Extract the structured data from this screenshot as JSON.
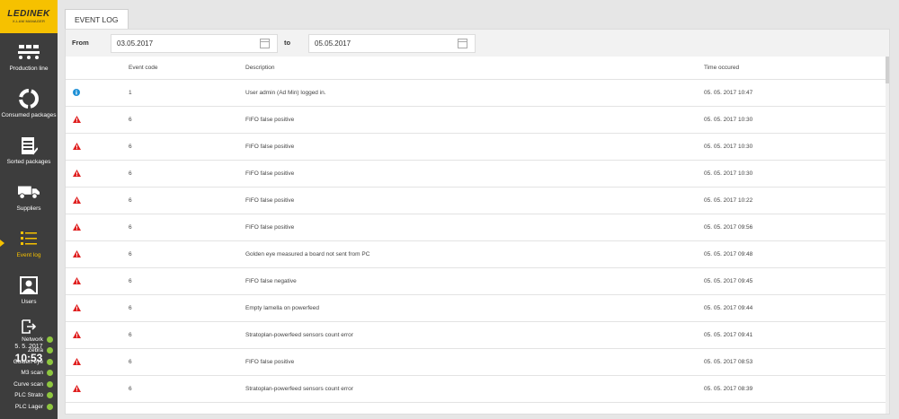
{
  "brand": {
    "name": "LEDINEK",
    "subtitle": "X-LAM MANAGER",
    "accent": "#f6c100"
  },
  "sidebar": {
    "items": [
      {
        "label": "Production line",
        "icon": "production-line-icon",
        "active": false
      },
      {
        "label": "Consumed packages",
        "icon": "consumed-packages-icon",
        "active": false
      },
      {
        "label": "Sorted packages",
        "icon": "sorted-packages-icon",
        "active": false
      },
      {
        "label": "Suppliers",
        "icon": "truck-icon",
        "active": false
      },
      {
        "label": "Event log",
        "icon": "list-icon",
        "active": true
      },
      {
        "label": "Users",
        "icon": "user-icon",
        "active": false
      }
    ],
    "logout_icon": "logout-icon"
  },
  "clock": {
    "date": "5. 5. 2017",
    "time": "10:53"
  },
  "statuses": [
    {
      "label": "Network",
      "color": "#8ec63f"
    },
    {
      "label": "Zebra",
      "color": "#8ec63f"
    },
    {
      "label": "Golden eye",
      "color": "#8ec63f"
    },
    {
      "label": "M3 scan",
      "color": "#8ec63f"
    },
    {
      "label": "Curve scan",
      "color": "#8ec63f"
    },
    {
      "label": "PLC Strato",
      "color": "#8ec63f"
    },
    {
      "label": "PLC Lager",
      "color": "#8ec63f"
    }
  ],
  "tab": {
    "label": "EVENT LOG"
  },
  "filter": {
    "from_label": "From",
    "from_value": "03.05.2017",
    "to_label": "to",
    "to_value": "05.05.2017"
  },
  "table": {
    "headers": {
      "code": "Event code",
      "description": "Description",
      "time": "Time occured"
    },
    "rows": [
      {
        "type": "info",
        "code": "1",
        "description": "User admin (Ad Min) logged in.",
        "time": "05. 05. 2017 10:47"
      },
      {
        "type": "warning",
        "code": "6",
        "description": "FIFO false positive",
        "time": "05. 05. 2017 10:30"
      },
      {
        "type": "warning",
        "code": "6",
        "description": "FIFO false positive",
        "time": "05. 05. 2017 10:30"
      },
      {
        "type": "warning",
        "code": "6",
        "description": "FIFO false positive",
        "time": "05. 05. 2017 10:30"
      },
      {
        "type": "warning",
        "code": "6",
        "description": "FIFO false positive",
        "time": "05. 05. 2017 10:22"
      },
      {
        "type": "warning",
        "code": "6",
        "description": "FIFO false positive",
        "time": "05. 05. 2017 09:56"
      },
      {
        "type": "warning",
        "code": "6",
        "description": "Golden eye measured a board not sent from PC",
        "time": "05. 05. 2017 09:48"
      },
      {
        "type": "warning",
        "code": "6",
        "description": "FIFO false negative",
        "time": "05. 05. 2017 09:45"
      },
      {
        "type": "warning",
        "code": "6",
        "description": "Empty lamella on powerfeed",
        "time": "05. 05. 2017 09:44"
      },
      {
        "type": "warning",
        "code": "6",
        "description": "Stratoplan-powerfeed sensors count error",
        "time": "05. 05. 2017 09:41"
      },
      {
        "type": "warning",
        "code": "6",
        "description": "FIFO false positive",
        "time": "05. 05. 2017 08:53"
      },
      {
        "type": "warning",
        "code": "6",
        "description": "Stratoplan-powerfeed sensors count error",
        "time": "05. 05. 2017 08:39"
      }
    ]
  },
  "colors": {
    "info": "#1e90d6",
    "warning": "#e02020",
    "status_ok": "#8ec63f"
  }
}
